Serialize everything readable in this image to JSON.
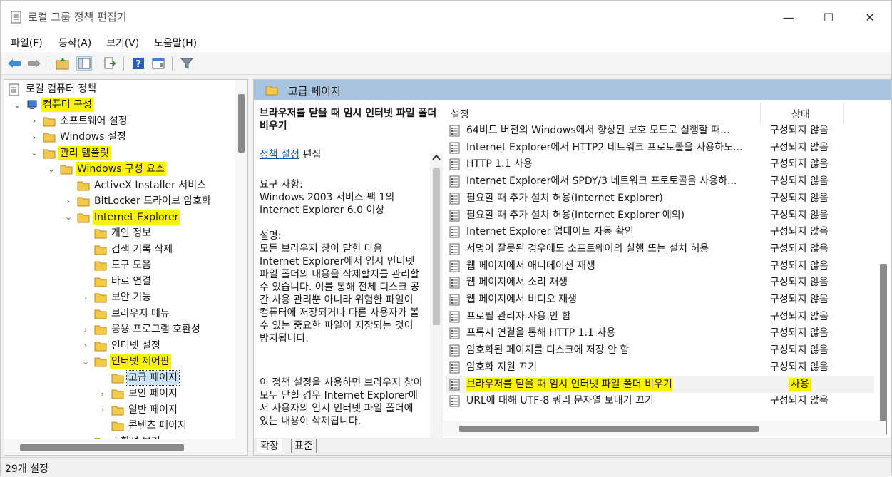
{
  "window": {
    "title": "로컬 그룹 정책 편집기",
    "minimize": "—",
    "maximize": "☐",
    "close": "✕"
  },
  "menu": [
    "파일(F)",
    "동작(A)",
    "보기(V)",
    "도움말(H)"
  ],
  "tree": {
    "root": "로컬 컴퓨터 정책",
    "items": [
      {
        "label": "컴퓨터 구성",
        "level": 1,
        "chev": "⌄",
        "hl": true
      },
      {
        "label": "소프트웨어 설정",
        "level": 2,
        "chev": "›"
      },
      {
        "label": "Windows 설정",
        "level": 2,
        "chev": "›"
      },
      {
        "label": "관리 템플릿",
        "level": 2,
        "chev": "⌄",
        "hl": true
      },
      {
        "label": "Windows 구성 요소",
        "level": 3,
        "chev": "⌄",
        "hl": true
      },
      {
        "label": "ActiveX Installer 서비스",
        "level": 4,
        "chev": ""
      },
      {
        "label": "BitLocker 드라이브 암호화",
        "level": 4,
        "chev": "›"
      },
      {
        "label": "Internet Explorer",
        "level": 4,
        "chev": "⌄",
        "hl": true
      },
      {
        "label": "개인 정보",
        "level": 5,
        "chev": ""
      },
      {
        "label": "검색 기록 삭제",
        "level": 5,
        "chev": ""
      },
      {
        "label": "도구 모음",
        "level": 5,
        "chev": ""
      },
      {
        "label": "바로 연결",
        "level": 5,
        "chev": ""
      },
      {
        "label": "보안 기능",
        "level": 5,
        "chev": "›"
      },
      {
        "label": "브라우저 메뉴",
        "level": 5,
        "chev": ""
      },
      {
        "label": "응용 프로그램 호환성",
        "level": 5,
        "chev": "›"
      },
      {
        "label": "인터넷 설정",
        "level": 5,
        "chev": "›"
      },
      {
        "label": "인터넷 제어판",
        "level": 5,
        "chev": "⌄",
        "hl": true
      },
      {
        "label": "고급 페이지",
        "level": 6,
        "chev": "",
        "hl": true,
        "sel": true
      },
      {
        "label": "보안 페이지",
        "level": 6,
        "chev": "›"
      },
      {
        "label": "일반 페이지",
        "level": 6,
        "chev": "›"
      },
      {
        "label": "콘텐츠 페이지",
        "level": 6,
        "chev": ""
      },
      {
        "label": "호환성 보기",
        "level": 5,
        "chev": ""
      }
    ]
  },
  "right": {
    "header": "고급 페이지",
    "desc": {
      "title": "브라우저를 닫을 때 임시 인터넷 파일 폴더 비우기",
      "policy_link": "정책 설정",
      "edit": "편집",
      "req_label": "요구 사항:",
      "req_text": "Windows 2003 서비스 팩 1의 Internet Explorer 6.0 이상",
      "desc_label": "설명:",
      "desc_text": "모든 브라우저 창이 닫힌 다음 Internet Explorer에서 임시 인터넷 파일 폴더의 내용을 삭제할지를 관리할 수 있습니다. 이를 통해 전체 디스크 공간 사용 관리뿐 아니라 위험한 파일이 컴퓨터에 저장되거나 다른 사용자가 볼 수 있는 중요한 파일이 저장되는 것이 방지됩니다.",
      "desc_text2": "이 정책 설정을 사용하면 브라우저 창이 모두 닫힐 경우 Internet Explorer에서 사용자의 임시 인터넷 파일 폴더에 있는 내용이 삭제됩니다."
    },
    "columns": {
      "setting": "설정",
      "state": "상태"
    },
    "rows": [
      {
        "name": "64비트 버전의 Windows에서 향상된 보호 모드로 실행할 때...",
        "state": "구성되지 않음"
      },
      {
        "name": "Internet Explorer에서 HTTP2 네트워크 프로토콜을 사용하도...",
        "state": "구성되지 않음"
      },
      {
        "name": "HTTP 1.1 사용",
        "state": "구성되지 않음"
      },
      {
        "name": "Internet Explorer에서 SPDY/3 네트워크 프로토콜을 사용하...",
        "state": "구성되지 않음"
      },
      {
        "name": "필요할 때 추가 설치 허용(Internet Explorer)",
        "state": "구성되지 않음"
      },
      {
        "name": "필요할 때 추가 설치 허용(Internet Explorer 예외)",
        "state": "구성되지 않음"
      },
      {
        "name": "Internet Explorer 업데이트 자동 확인",
        "state": "구성되지 않음"
      },
      {
        "name": "서명이 잘못된 경우에도 소프트웨어의 실행 또는 설치 허용",
        "state": "구성되지 않음"
      },
      {
        "name": "웹 페이지에서 애니메이션 재생",
        "state": "구성되지 않음"
      },
      {
        "name": "웹 페이지에서 소리 재생",
        "state": "구성되지 않음"
      },
      {
        "name": "웹 페이지에서 비디오 재생",
        "state": "구성되지 않음"
      },
      {
        "name": "프로필 관리자 사용 안 함",
        "state": "구성되지 않음"
      },
      {
        "name": "프록시 연결을 통해 HTTP 1.1 사용",
        "state": "구성되지 않음"
      },
      {
        "name": "암호화된 페이지를 디스크에 저장 안 함",
        "state": "구성되지 않음"
      },
      {
        "name": "암호화 지원 끄기",
        "state": "구성되지 않음"
      },
      {
        "name": "브라우저를 닫을 때 임시 인터넷 파일 폴더 비우기",
        "state": "사용",
        "hl": true
      },
      {
        "name": "URL에 대해 UTF-8 쿼리 문자열 보내기 끄기",
        "state": "구성되지 않음"
      }
    ],
    "tabs": [
      "확장",
      "표준"
    ]
  },
  "status": "29개 설정"
}
